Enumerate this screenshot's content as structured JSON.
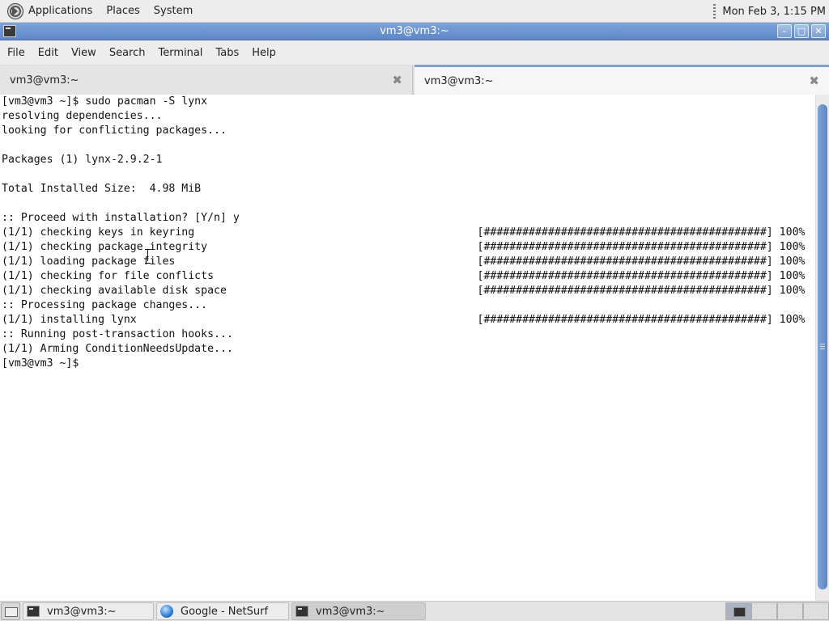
{
  "top_panel": {
    "menus": [
      "Applications",
      "Places",
      "System"
    ],
    "clock": "Mon Feb  3,  1:15 PM"
  },
  "window": {
    "title": "vm3@vm3:~",
    "buttons": {
      "minimize": "–",
      "maximize": "□",
      "close": "✕"
    }
  },
  "menubar": [
    "File",
    "Edit",
    "View",
    "Search",
    "Terminal",
    "Tabs",
    "Help"
  ],
  "tabs": [
    {
      "label": "vm3@vm3:~",
      "active": false
    },
    {
      "label": "vm3@vm3:~",
      "active": true
    }
  ],
  "terminal": {
    "lines": [
      "[vm3@vm3 ~]$ sudo pacman -S lynx",
      "resolving dependencies...",
      "looking for conflicting packages...",
      "",
      "Packages (1) lynx-2.9.2-1",
      "",
      "Total Installed Size:  4.98 MiB",
      "",
      ":: Proceed with installation? [Y/n] y",
      "(1/1) checking keys in keyring                                            [############################################] 100%",
      "(1/1) checking package integrity                                          [############################################] 100%",
      "(1/1) loading package files                                               [############################################] 100%",
      "(1/1) checking for file conflicts                                         [############################################] 100%",
      "(1/1) checking available disk space                                       [############################################] 100%",
      ":: Processing package changes...",
      "(1/1) installing lynx                                                     [############################################] 100%",
      ":: Running post-transaction hooks...",
      "(1/1) Arming ConditionNeedsUpdate...",
      "[vm3@vm3 ~]$ "
    ]
  },
  "taskbar": {
    "tasks": [
      {
        "label": "vm3@vm3:~",
        "icon": "terminal-icon",
        "active": false
      },
      {
        "label": "Google - NetSurf",
        "icon": "netsurf-globe-icon",
        "active": false
      },
      {
        "label": "vm3@vm3:~",
        "icon": "terminal-icon",
        "active": true
      }
    ],
    "workspace_count": 4
  }
}
